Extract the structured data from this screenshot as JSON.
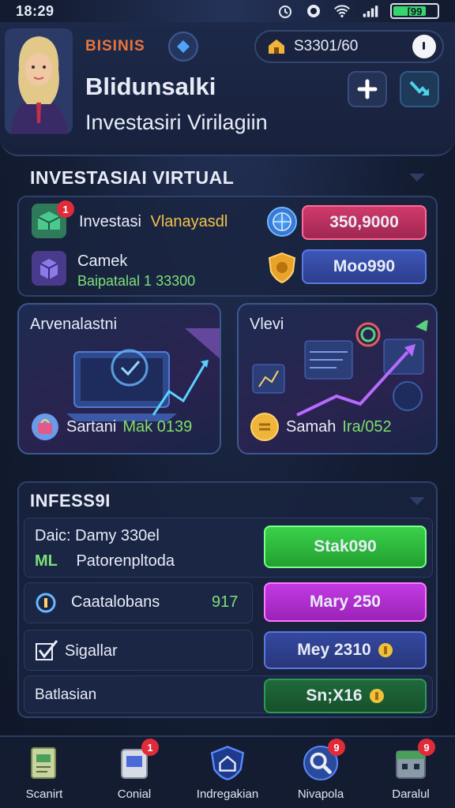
{
  "status_bar": {
    "time": "18:29",
    "battery": "[99"
  },
  "header": {
    "tagline": "BISINIS",
    "balance": "S3301/60",
    "title": "Blidunsalki",
    "subtitle": "Investasiri Virilagiin"
  },
  "virtual_section": {
    "title": "INVESTASIAI VIRTUAL",
    "rows": [
      {
        "label": "Investasi",
        "label_accent": "Vlanayasdl",
        "value": "350,9000",
        "badge": "1"
      },
      {
        "label": "Camek",
        "sublabel": "Baipatalal 1 33300",
        "value": "Moo990"
      }
    ],
    "cards": [
      {
        "title": "Arvenalastni",
        "footer": "Sartani",
        "footer_accent": "Mak 0139"
      },
      {
        "title": "Vlevi",
        "footer": "Samah",
        "footer_accent": "Ira/052"
      }
    ]
  },
  "info_section": {
    "title": "INFESS9I",
    "rows": [
      {
        "label": "Daic: Damy 330el",
        "sublabel_prefix": "ML",
        "sublabel": "Patorenpltoda",
        "button": "Stak090"
      },
      {
        "label": "Caatalobans",
        "value": "917",
        "button": "Mary 250"
      },
      {
        "label": "Sigallar",
        "button": "Mey 2310"
      },
      {
        "label": "Batlasian",
        "button": "Sn;X16"
      }
    ]
  },
  "bottom_nav": [
    {
      "label": "Scanirt",
      "badge": ""
    },
    {
      "label": "Conial",
      "badge": "1"
    },
    {
      "label": "Indregakian",
      "badge": ""
    },
    {
      "label": "Nivapola",
      "badge": "9"
    },
    {
      "label": "Daralul",
      "badge": "9"
    }
  ],
  "colors": {
    "accent_orange": "#e8763a",
    "pink_button": "#c2305f",
    "blue_button": "#3548a0",
    "green_button": "#2fbf3a",
    "magenta_button": "#b734d8",
    "background": "#141d33"
  }
}
